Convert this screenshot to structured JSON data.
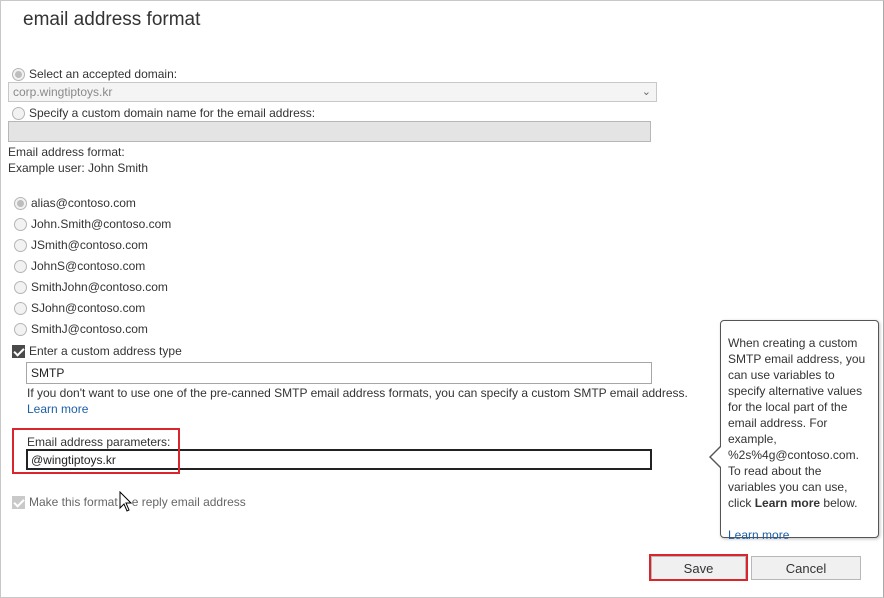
{
  "dialog": {
    "title": "email address format"
  },
  "domain": {
    "accepted_label": "Select an accepted domain:",
    "accepted_value": "corp.wingtiptoys.kr",
    "custom_label": "Specify a custom domain name for the email address:",
    "custom_value": ""
  },
  "format": {
    "heading": "Email address format:",
    "example": "Example user: John Smith",
    "options": [
      {
        "label": "alias@contoso.com",
        "checked": true
      },
      {
        "label": "John.Smith@contoso.com",
        "checked": false
      },
      {
        "label": "JSmith@contoso.com",
        "checked": false
      },
      {
        "label": "JohnS@contoso.com",
        "checked": false
      },
      {
        "label": "SmithJohn@contoso.com",
        "checked": false
      },
      {
        "label": "SJohn@contoso.com",
        "checked": false
      },
      {
        "label": "SmithJ@contoso.com",
        "checked": false
      }
    ]
  },
  "custom": {
    "checkbox_label": "Enter a custom address type",
    "checked": true,
    "type_value": "SMTP",
    "help_text": "If you don't want to use one of the pre-canned SMTP email address formats, you can specify a custom SMTP email address.",
    "learn_more": "Learn more",
    "params_label": "Email address parameters:",
    "params_value": "@wingtiptoys.kr"
  },
  "reply": {
    "label_before": "Make this format",
    "label_after": "e reply email address",
    "checked": true
  },
  "callout": {
    "text_1": "When creating a custom SMTP email address, you can use variables to specify alternative values for the local part of the email address. For example, %2s%4g@contoso.com. To read about the variables you can use, click",
    "bold": "Learn more",
    "text_2": "below.",
    "link": "Learn more"
  },
  "buttons": {
    "save": "Save",
    "cancel": "Cancel"
  },
  "colors": {
    "highlight": "#d9252b",
    "link": "#1c5fa8"
  }
}
